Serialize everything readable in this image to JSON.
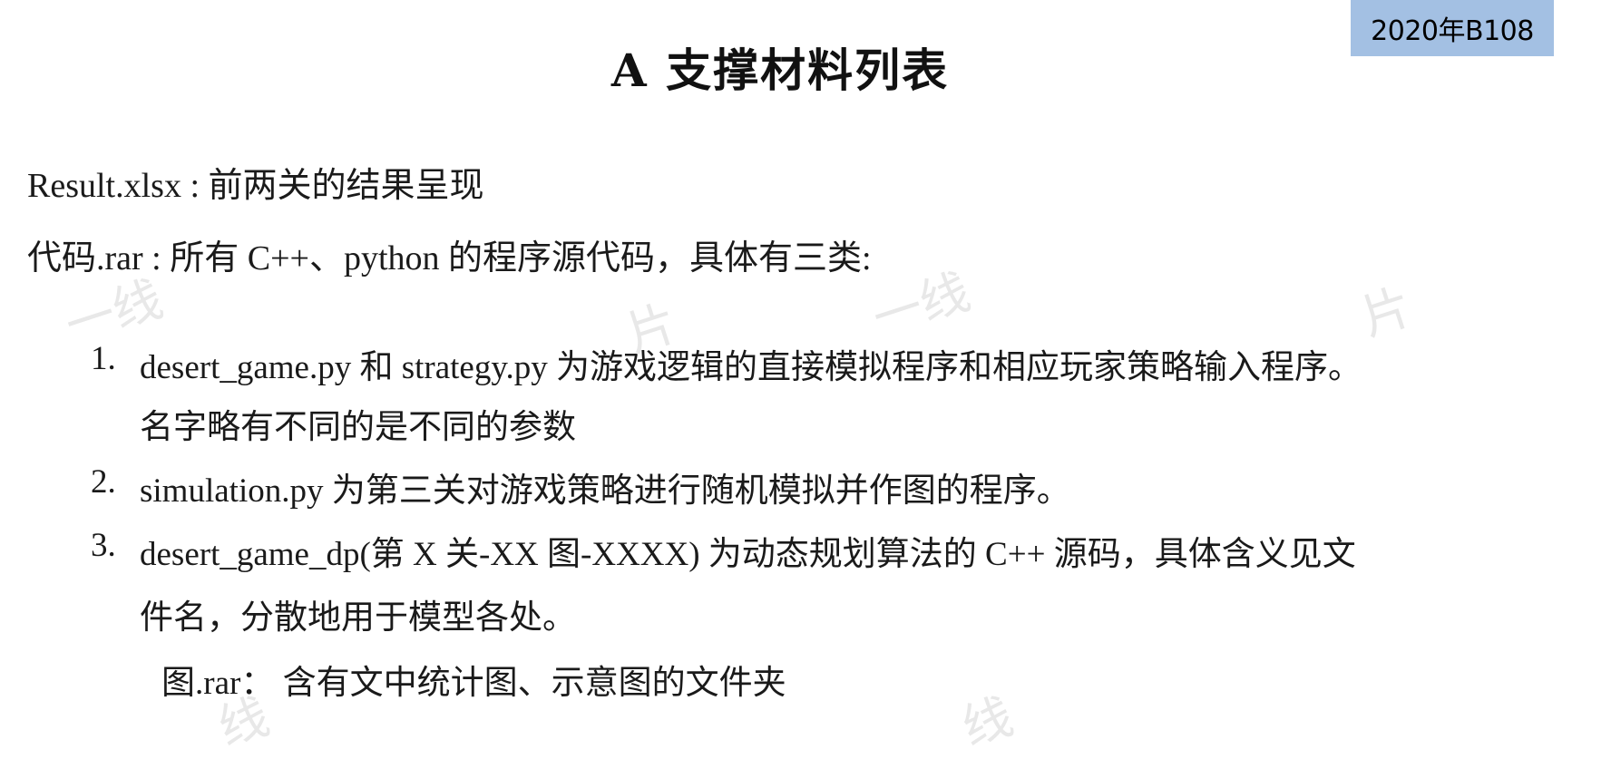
{
  "badge": "2020年B108",
  "title": "A 支撑材料列表",
  "lines": {
    "result": "Result.xlsx : 前两关的结果呈现",
    "code": "代码.rar : 所有 C++、python 的程序源代码，具体有三类:"
  },
  "list": [
    {
      "num": "1.",
      "line1": "desert_game.py 和 strategy.py 为游戏逻辑的直接模拟程序和相应玩家策略输入程序。",
      "line2": "名字略有不同的是不同的参数"
    },
    {
      "num": "2.",
      "line1": "simulation.py 为第三关对游戏策略进行随机模拟并作图的程序。"
    },
    {
      "num": "3.",
      "line1": "desert_game_dp(第 X 关-XX 图-XXXX) 为动态规划算法的 C++ 源码，具体含义见文",
      "line2": "件名，分散地用于模型各处。"
    }
  ],
  "figures": "图.rar： 含有文中统计图、示意图的文件夹",
  "watermarks": [
    "一线",
    "片",
    "一线",
    "片",
    "线",
    "线"
  ]
}
